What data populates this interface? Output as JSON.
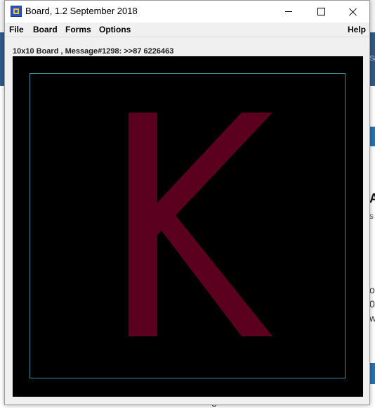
{
  "background": {
    "fragments": [
      "A",
      "s",
      "of",
      "0",
      "w",
      "Sa"
    ],
    "footer_text": "Color Images"
  },
  "window": {
    "title": "Board, 1.2 September 2018",
    "controls": {
      "minimize": "minimize-icon",
      "maximize": "maximize-icon",
      "close": "close-icon"
    }
  },
  "menu": {
    "file": "File",
    "board": "Board",
    "forms": "Forms",
    "options": "Options",
    "help": "Help"
  },
  "board": {
    "label": "10x10 Board , Message#1298: >>87 6226463",
    "letter": "K",
    "letter_color": "#5c0020",
    "background_color": "#000000",
    "frame_color": "#2f8f96"
  }
}
